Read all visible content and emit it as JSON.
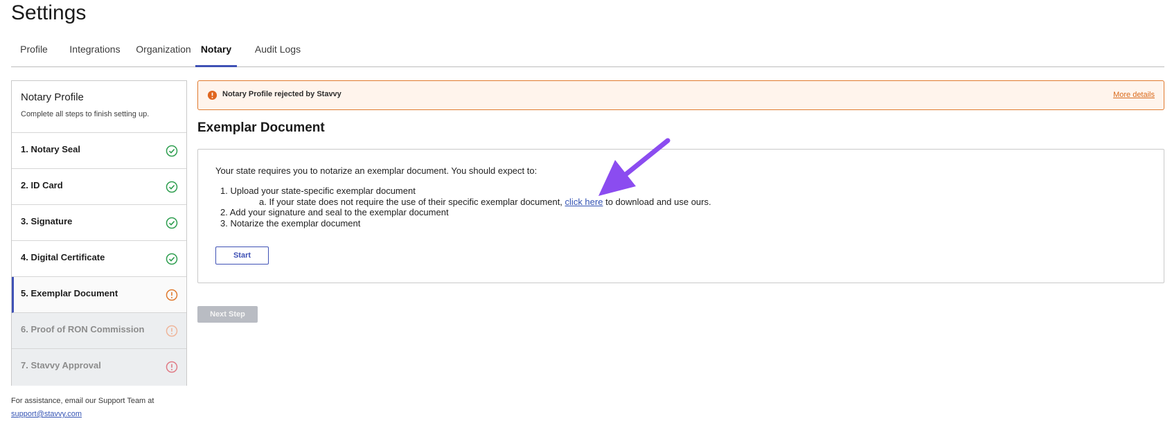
{
  "page": {
    "title": "Settings"
  },
  "tabs": [
    {
      "label": "Profile",
      "active": false
    },
    {
      "label": "Integrations",
      "active": false
    },
    {
      "label": "Organization",
      "active": false
    },
    {
      "label": "Notary",
      "active": true
    },
    {
      "label": "Audit Logs",
      "active": false
    }
  ],
  "sidebar": {
    "title": "Notary Profile",
    "subtitle": "Complete all steps to finish setting up.",
    "steps": [
      {
        "label": "1. Notary Seal",
        "status": "complete",
        "status_icon": "check-circle-icon"
      },
      {
        "label": "2. ID Card",
        "status": "complete",
        "status_icon": "check-circle-icon"
      },
      {
        "label": "3. Signature",
        "status": "complete",
        "status_icon": "check-circle-icon"
      },
      {
        "label": "4. Digital Certificate",
        "status": "complete",
        "status_icon": "check-circle-icon"
      },
      {
        "label": "5. Exemplar Document",
        "status": "warning",
        "status_icon": "exclamation-circle-icon"
      },
      {
        "label": "6. Proof of RON Commission",
        "status": "pending",
        "status_icon": "exclamation-circle-icon"
      },
      {
        "label": "7. Stavvy Approval",
        "status": "pending",
        "status_icon": "exclamation-circle-icon"
      }
    ]
  },
  "help": {
    "text": "For assistance, email our Support Team at",
    "email": "support@stavvy.com"
  },
  "alert": {
    "message": "Notary Profile rejected by Stavvy",
    "link": "More details",
    "icon": "exclamation-circle-icon"
  },
  "main": {
    "section_title": "Exemplar Document",
    "intro": "Your state requires you to notarize an exemplar document. You should expect to:",
    "list": {
      "item1": "Upload your state-specific exemplar document",
      "sub_a_before": "If your state does not require the use of their specific exemplar document,",
      "sub_a_link": "click here",
      "sub_a_after": "to download and use ours.",
      "item2": "Add your signature and seal to the exemplar document",
      "item3": "Notarize the exemplar document",
      "markers": [
        "1.",
        "a.",
        "2.",
        "3."
      ]
    },
    "start_button": "Start",
    "next_button": "Next Step"
  },
  "colors": {
    "accent": "#3f51b5",
    "success": "#2e9e4f",
    "warning": "#e07a2f",
    "pending": "#e79aa0",
    "annotation_arrow": "#8b4cf0"
  }
}
